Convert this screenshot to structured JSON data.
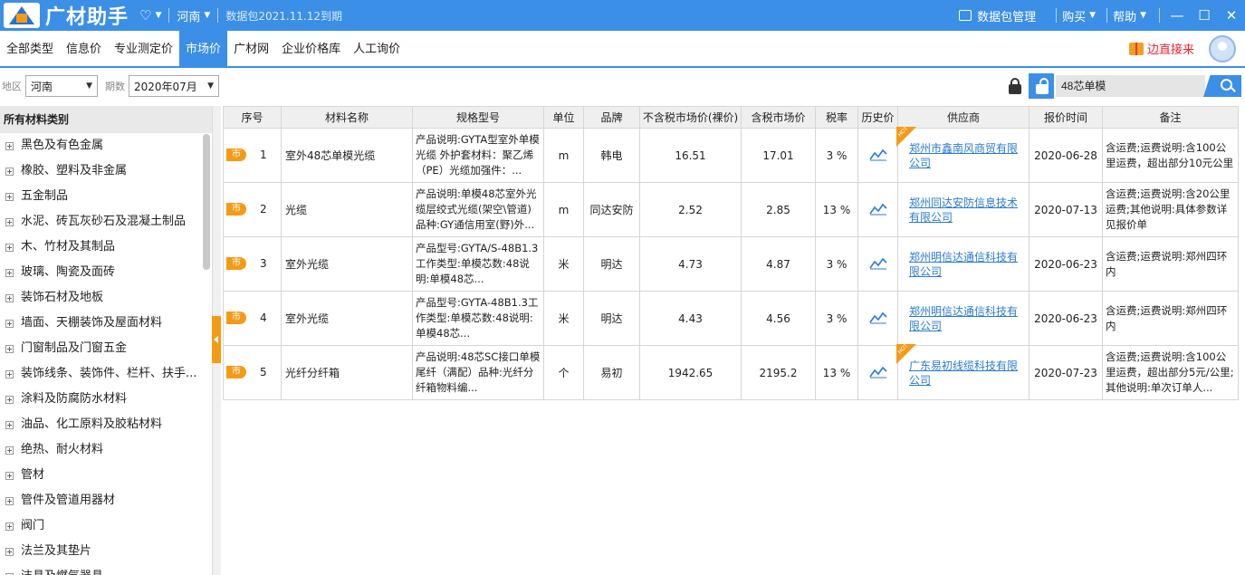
{
  "app": {
    "title": "广材助手",
    "region": "河南",
    "package_info": "数据包2021.11.12到期",
    "data_pkg_label": "数据包管理",
    "buy_label": "购买",
    "help_label": "帮助"
  },
  "nav": {
    "tabs": [
      "全部类型",
      "信息价",
      "专业测定价",
      "市场价",
      "广材网",
      "企业价格库",
      "人工询价"
    ],
    "active": "市场价",
    "promo": "边直接来"
  },
  "filters": {
    "region_label": "地区",
    "region_value": "河南",
    "period_label": "期数",
    "period_value": "2020年07月",
    "search_value": "48芯单模"
  },
  "sidebar": {
    "header": "所有材料类别",
    "items": [
      "黑色及有色金属",
      "橡胶、塑料及非金属",
      "五金制品",
      "水泥、砖瓦灰砂石及混凝土制品",
      "木、竹材及其制品",
      "玻璃、陶瓷及面砖",
      "装饰石材及地板",
      "墙面、天棚装饰及屋面材料",
      "门窗制品及门窗五金",
      "装饰线条、装饰件、栏杆、扶手...",
      "涂料及防腐防水材料",
      "油品、化工原料及胶粘材料",
      "绝热、耐火材料",
      "管材",
      "管件及管道用器材",
      "阀门",
      "法兰及其垫片",
      "洁具及燃气器具"
    ]
  },
  "table": {
    "headers": [
      "序号",
      "材料名称",
      "规格型号",
      "单位",
      "品牌",
      "不含税市场价(裸价)",
      "含税市场价",
      "税率",
      "历史价",
      "供应商",
      "报价时间",
      "备注"
    ],
    "badge": "市",
    "hot_label": "HOT",
    "rows": [
      {
        "idx": "1",
        "name": "室外48芯单模光缆",
        "spec": "产品说明:GYTA型室外单模光缆 外护套材料：聚乙烯（PE）光缆加强件：...",
        "unit": "m",
        "brand": "韩电",
        "price_ex": "16.51",
        "price_in": "17.01",
        "tax": "3 %",
        "supplier": "郑州市鑫南风商贸有限公司",
        "date": "2020-06-28",
        "note": "含运费;运费说明:含100公里运费，超出部分10元公里",
        "hot": true
      },
      {
        "idx": "2",
        "name": "光缆",
        "spec": "产品说明:单模48芯室外光缆层绞式光缆(架空\\管道)品种:GY通信用室(野)外...",
        "unit": "m",
        "brand": "同达安防",
        "price_ex": "2.52",
        "price_in": "2.85",
        "tax": "13 %",
        "supplier": "郑州同达安防信息技术有限公司",
        "date": "2020-07-13",
        "note": "含运费;运费说明:含20公里运费;其他说明:具体参数详见报价单",
        "hot": false
      },
      {
        "idx": "3",
        "name": "室外光缆",
        "spec": "产品型号:GYTA/S-48B1.3工作类型:单模芯数:48说明:单模48芯...",
        "unit": "米",
        "brand": "明达",
        "price_ex": "4.73",
        "price_in": "4.87",
        "tax": "3 %",
        "supplier": "郑州明信达通信科技有限公司",
        "date": "2020-06-23",
        "note": "含运费;运费说明:郑州四环内",
        "hot": false
      },
      {
        "idx": "4",
        "name": "室外光缆",
        "spec": "产品型号:GYTA-48B1.3工作类型:单模芯数:48说明:单模48芯...",
        "unit": "米",
        "brand": "明达",
        "price_ex": "4.43",
        "price_in": "4.56",
        "tax": "3 %",
        "supplier": "郑州明信达通信科技有限公司",
        "date": "2020-06-23",
        "note": "含运费;运费说明:郑州四环内",
        "hot": false
      },
      {
        "idx": "5",
        "name": "光纤分纤箱",
        "spec": "产品说明:48芯SC接口单模尾纤（满配）品种:光纤分纤箱物料编...",
        "unit": "个",
        "brand": "易初",
        "price_ex": "1942.65",
        "price_in": "2195.2",
        "tax": "13 %",
        "supplier": "广东易初线缆科技有限公司",
        "date": "2020-07-23",
        "note": "含运费;运费说明:含100公里运费，超出部分5元/公里;其他说明:单次订单人...",
        "hot": true
      }
    ]
  },
  "colors": {
    "accent": "#3b8fe6",
    "badge": "#f39b16",
    "link": "#2a7bd5"
  },
  "icons": [
    "heart-icon",
    "package-icon",
    "lock-icon",
    "unlock-icon",
    "search-icon",
    "gift-icon",
    "avatar-icon",
    "chart-icon",
    "expand-icon"
  ]
}
